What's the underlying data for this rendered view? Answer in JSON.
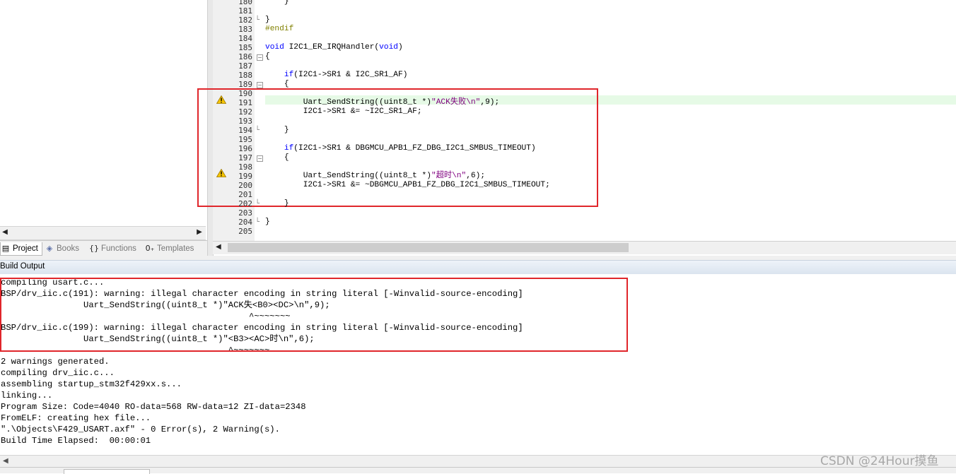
{
  "project_pane": {
    "tabs": [
      {
        "label": "Project",
        "icon": "project-icon",
        "active": true
      },
      {
        "label": "Books",
        "icon": "books-icon",
        "active": false
      },
      {
        "label": "Functions",
        "icon": "functions-icon",
        "active": false
      },
      {
        "label": "Templates",
        "icon": "templates-icon",
        "active": false
      }
    ]
  },
  "editor": {
    "lines": [
      {
        "num": "180",
        "text": "    }"
      },
      {
        "num": "181",
        "text": ""
      },
      {
        "num": "182",
        "text": "}"
      },
      {
        "num": "183",
        "text": "#endif"
      },
      {
        "num": "184",
        "text": ""
      },
      {
        "num": "185",
        "text": "void I2C1_ER_IRQHandler(void)"
      },
      {
        "num": "186",
        "text": "{"
      },
      {
        "num": "187",
        "text": ""
      },
      {
        "num": "188",
        "text": "    if(I2C1->SR1 & I2C_SR1_AF)"
      },
      {
        "num": "189",
        "text": "    {"
      },
      {
        "num": "190",
        "text": ""
      },
      {
        "num": "191",
        "text": "        Uart_SendString((uint8_t *)\"ACK失败\\n\",9);"
      },
      {
        "num": "192",
        "text": "        I2C1->SR1 &= ~I2C_SR1_AF;"
      },
      {
        "num": "193",
        "text": ""
      },
      {
        "num": "194",
        "text": "    }"
      },
      {
        "num": "195",
        "text": ""
      },
      {
        "num": "196",
        "text": "    if(I2C1->SR1 & DBGMCU_APB1_FZ_DBG_I2C1_SMBUS_TIMEOUT)"
      },
      {
        "num": "197",
        "text": "    {"
      },
      {
        "num": "198",
        "text": ""
      },
      {
        "num": "199",
        "text": "        Uart_SendString((uint8_t *)\"超时\\n\",6);"
      },
      {
        "num": "200",
        "text": "        I2C1->SR1 &= ~DBGMCU_APB1_FZ_DBG_I2C1_SMBUS_TIMEOUT;"
      },
      {
        "num": "201",
        "text": ""
      },
      {
        "num": "202",
        "text": "    }"
      },
      {
        "num": "203",
        "text": ""
      },
      {
        "num": "204",
        "text": "}"
      },
      {
        "num": "205",
        "text": ""
      }
    ],
    "highlight_line": "191",
    "warning_lines": [
      "191",
      "199"
    ]
  },
  "build_output": {
    "title": "Build Output",
    "lines": [
      "compiling usart.c...",
      "BSP/drv_iic.c(191): warning: illegal character encoding in string literal [-Winvalid-source-encoding]",
      "                Uart_SendString((uint8_t *)\"ACK失<B0><DC>\\n\",9);",
      "                                                ^~~~~~~~",
      "BSP/drv_iic.c(199): warning: illegal character encoding in string literal [-Winvalid-source-encoding]",
      "                Uart_SendString((uint8_t *)\"<B3><AC>时\\n\",6);",
      "                                            ^~~~~~~~",
      "2 warnings generated.",
      "compiling drv_iic.c...",
      "assembling startup_stm32f429xx.s...",
      "linking...",
      "Program Size: Code=4040 RO-data=568 RW-data=12 ZI-data=2348",
      "FromELF: creating hex file...",
      "\".\\Objects\\F429_USART.axf\" - 0 Error(s), 2 Warning(s).",
      "Build Time Elapsed:  00:00:01"
    ]
  },
  "watermark": "CSDN @24Hour摸鱼",
  "colors": {
    "annotation_red": "#e0262b",
    "keyword_blue": "#0000ff",
    "string_purple": "#800080",
    "preprocessor_olive": "#808000",
    "line_highlight": "#e6fae6",
    "warning_yellow": "#f5c400"
  }
}
